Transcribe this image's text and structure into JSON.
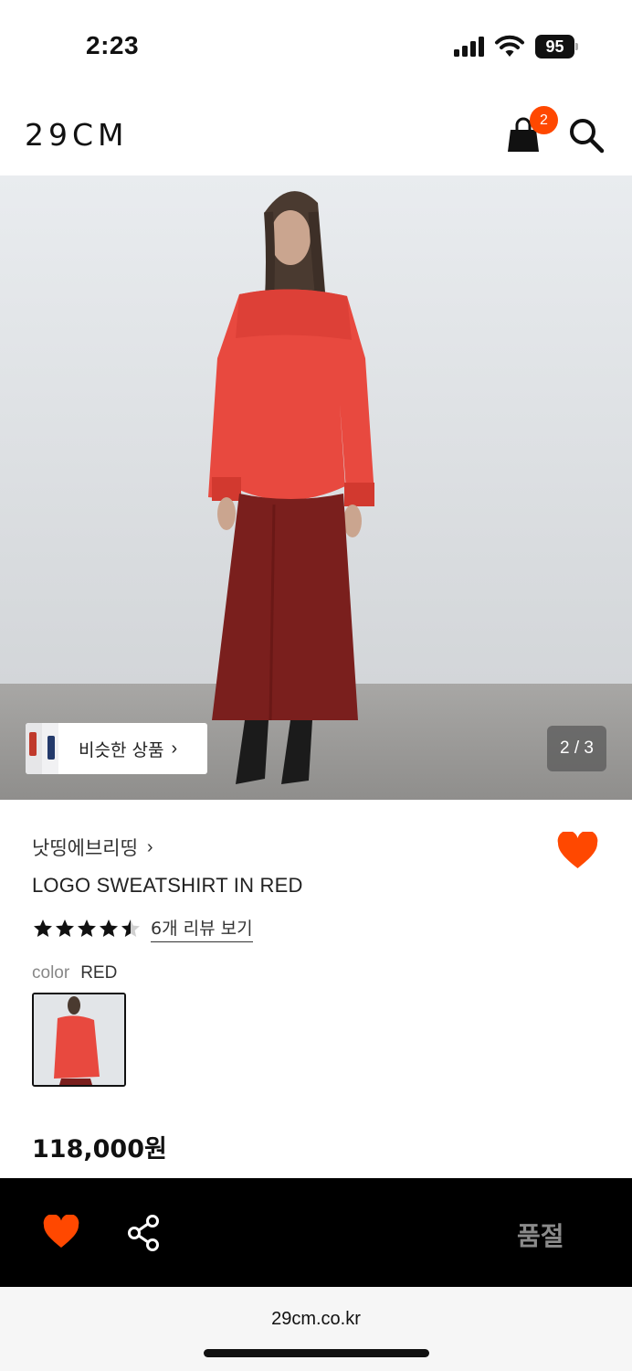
{
  "status_bar": {
    "time": "2:23",
    "battery": "95"
  },
  "header": {
    "logo": "29CM",
    "cart_count": "2"
  },
  "hero": {
    "similar_label": "비슷한 상품",
    "page_counter": "2 / 3"
  },
  "product": {
    "brand": "낫띵에브리띵",
    "title": "LOGO SWEATSHIRT IN RED",
    "rating": 4.5,
    "review_link": "6개 리뷰 보기",
    "color_key": "color",
    "color_value": "RED",
    "price": "118,000원"
  },
  "bottom_bar": {
    "soldout_label": "품절"
  },
  "browser": {
    "url": "29cm.co.kr"
  },
  "colors": {
    "accent": "#ff4800",
    "bar": "#000000"
  },
  "icons": [
    "signal-icon",
    "wifi-icon",
    "battery-icon",
    "cart-icon",
    "search-icon",
    "heart-icon",
    "share-icon",
    "star-icon",
    "chevron-right-icon"
  ]
}
